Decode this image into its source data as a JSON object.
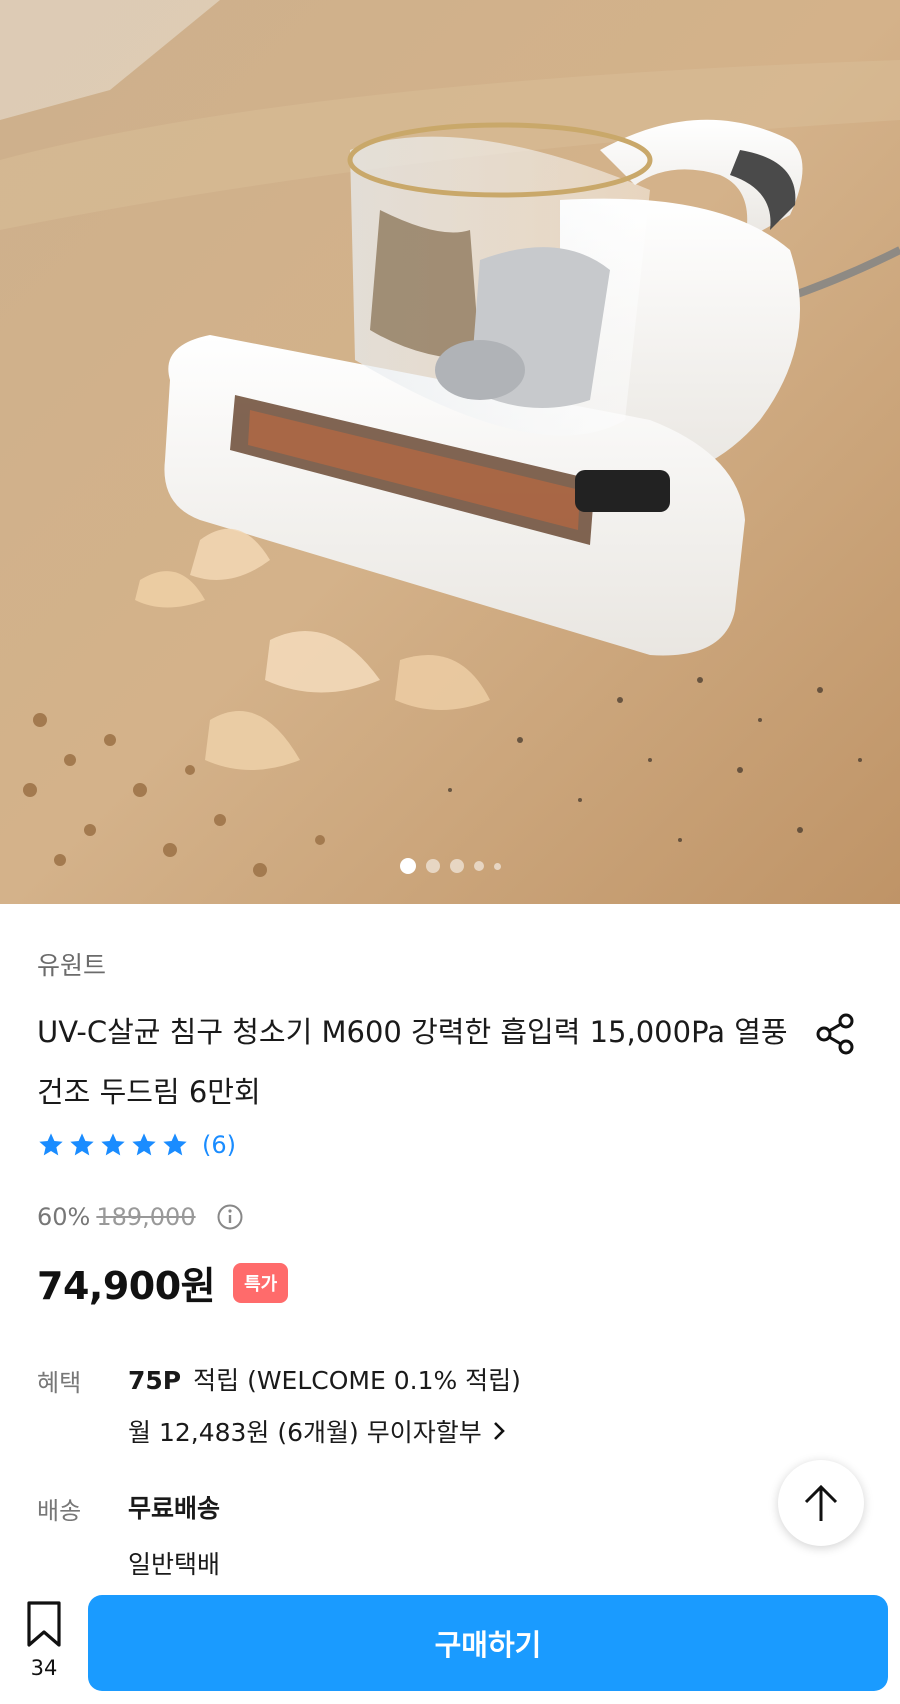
{
  "hero": {
    "image_label": "UV-C 침구 청소기 제품 사진",
    "carousel": {
      "count": 5,
      "active_index": 0
    }
  },
  "product": {
    "brand": "유원트",
    "title": "UV-C살균 침구 청소기 M600 강력한 흡입력 15,000Pa 열풍건조 두드림 6만회",
    "rating": {
      "stars": 5,
      "count_text": "(6)"
    },
    "discount": "60%",
    "original_price": "189,000",
    "final_price": "74,900원",
    "badge": "특가"
  },
  "benefits": {
    "label": "혜택",
    "points": "75P",
    "points_text": "적립 (WELCOME 0.1% 적립)",
    "installment": "월 12,483원 (6개월) 무이자할부"
  },
  "shipping": {
    "label": "배송",
    "fee": "무료배송",
    "method": "일반택배"
  },
  "bottom_bar": {
    "bookmark_count": "34",
    "buy_label": "구매하기"
  },
  "colors": {
    "accent": "#1a9bff",
    "star": "#1a8cff",
    "badge": "#ff6b6b"
  },
  "icons": [
    "share-icon",
    "star-icon",
    "info-icon",
    "chevron-right-icon",
    "arrow-up-icon",
    "bookmark-icon"
  ]
}
